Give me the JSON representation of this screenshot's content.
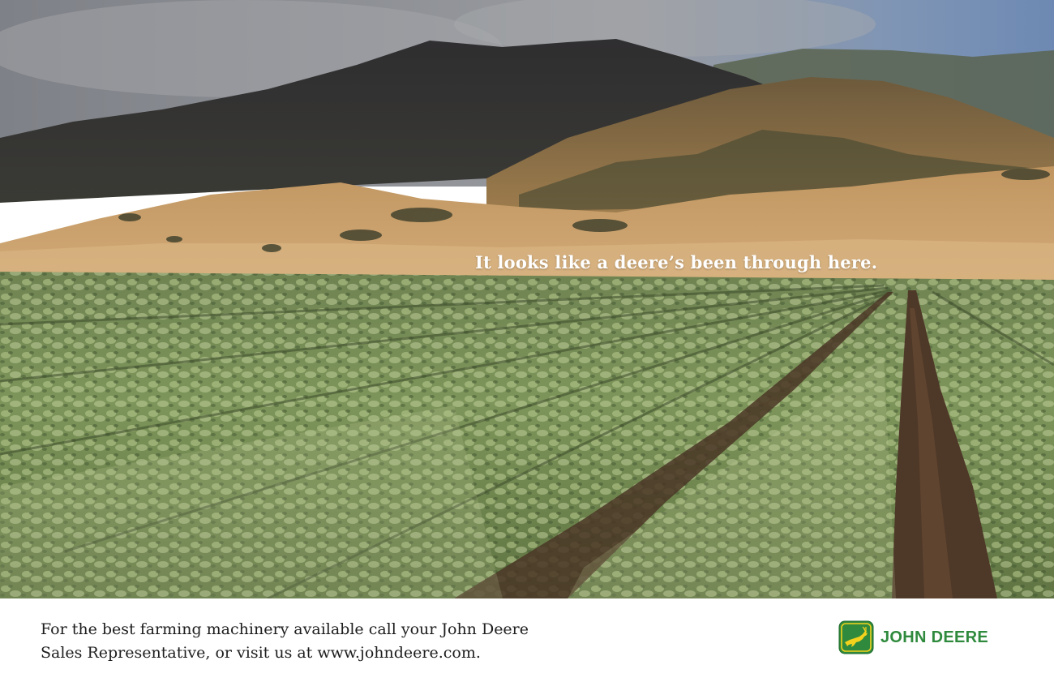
{
  "ad": {
    "headline": "It looks like a deere’s been through here.",
    "body_lines": [
      "For the best farming machinery available call your John Deere",
      "Sales Representative, or visit us at www.johndeere.com."
    ],
    "brand_name": "JOHN DEERE"
  },
  "colors": {
    "brand_green": "#2f8a3d",
    "brand_yellow": "#f2d21c",
    "sky": "#8a8d92",
    "lettuce": "#8fa66a",
    "soil": "#4a3626"
  },
  "icons": {
    "logo": "leaping-deer-icon"
  }
}
